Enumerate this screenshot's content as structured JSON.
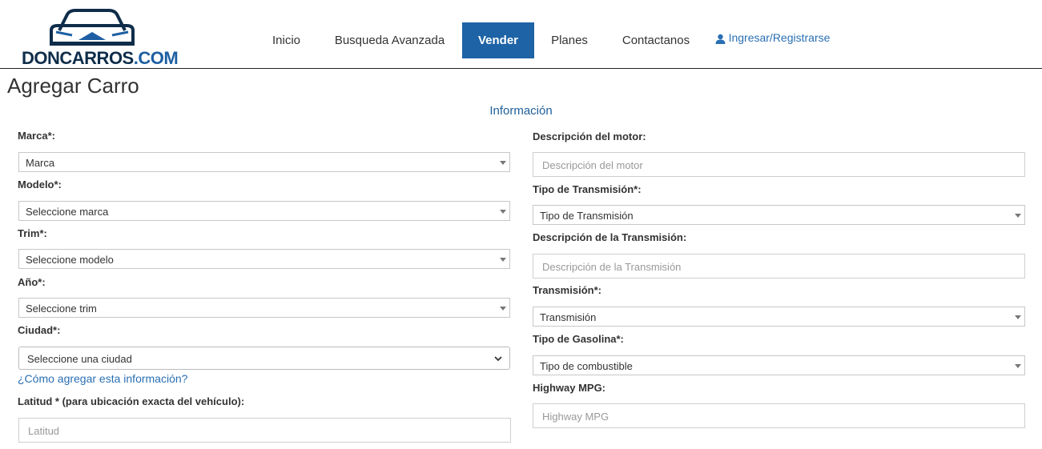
{
  "logo": {
    "name": "DONCARROS",
    "suffix": ".COM"
  },
  "nav": {
    "items": [
      {
        "label": "Inicio"
      },
      {
        "label": "Busqueda Avanzada"
      },
      {
        "label": "Vender"
      },
      {
        "label": "Planes"
      },
      {
        "label": "Contactanos"
      }
    ],
    "login_label": "Ingresar/Registrarse",
    "active_color": "#1e63a6"
  },
  "page_title": "Agregar Carro",
  "section_title": "Información",
  "left": {
    "marca": {
      "label": "Marca*:",
      "value": "Marca"
    },
    "modelo": {
      "label": "Modelo*:",
      "value": "Seleccione marca"
    },
    "trim": {
      "label": "Trim*:",
      "value": "Seleccione modelo"
    },
    "anio": {
      "label": "Año*:",
      "value": "Seleccione trim"
    },
    "ciudad": {
      "label": "Ciudad*:",
      "value": "Seleccione una ciudad"
    },
    "help_link": "¿Cómo agregar esta información?",
    "latitud": {
      "label": "Latitud * (para ubicación exacta del vehículo):",
      "placeholder": "Latitud"
    }
  },
  "right": {
    "motor": {
      "label": "Descripción del motor:",
      "placeholder": "Descripción del motor"
    },
    "tipo_transmision": {
      "label": "Tipo de Transmisión*:",
      "value": "Tipo de Transmisión"
    },
    "desc_transmision": {
      "label": "Descripción de la Transmisión:",
      "placeholder": "Descripción de la Transmisión"
    },
    "transmision": {
      "label": "Transmisión*:",
      "value": "Transmisión"
    },
    "gasolina": {
      "label": "Tipo de Gasolina*:",
      "value": "Tipo de combustible"
    },
    "mpg": {
      "label": "Highway MPG:",
      "placeholder": "Highway MPG"
    }
  }
}
